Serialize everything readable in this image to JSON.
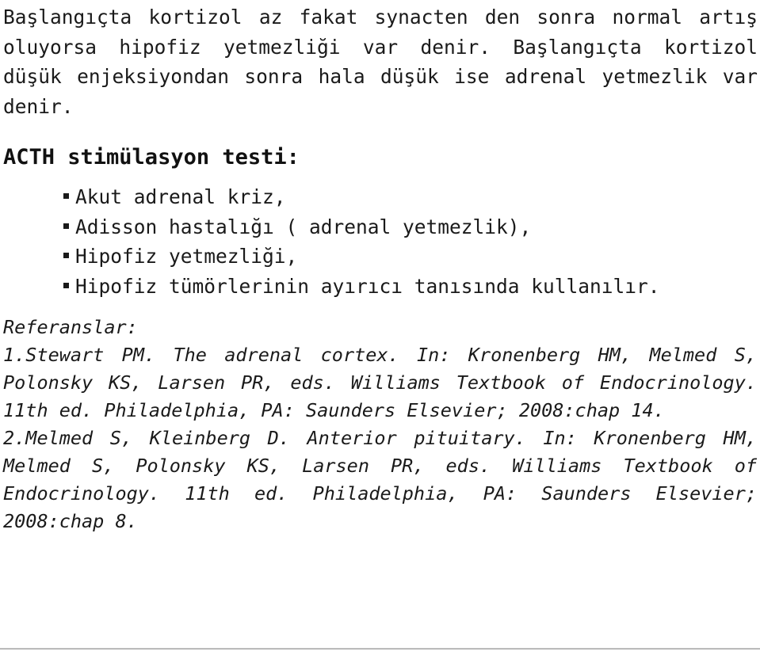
{
  "document": {
    "background_color": "#ffffff",
    "text_color": "#1a1a1a",
    "divider_color": "#a8a8a8"
  },
  "intro": {
    "paragraph": "Başlangıçta kortizol az fakat synacten den sonra normal artış oluyorsa hipofiz yetmezliği var denir. Başlangıçta kortizol düşük enjeksiyondan sonra hala düşük ise adrenal yetmezlik var denir."
  },
  "section": {
    "heading": "ACTH stimülasyon testi:",
    "bullet_glyph": "square-bullet-icon",
    "bullets": [
      {
        "label": "Akut adrenal kriz,"
      },
      {
        "label": "Adisson hastalığı ( adrenal yetmezlik),"
      },
      {
        "label": "Hipofiz yetmezliği,"
      },
      {
        "label": "Hipofiz tümörlerinin ayırıcı tanısında kullanılır."
      }
    ]
  },
  "references": {
    "title": "Referanslar:",
    "items": [
      {
        "number": "1.",
        "text": "1.Stewart PM. The adrenal cortex. In: Kronenberg HM, Melmed S, Polonsky KS, Larsen PR, eds. Williams Textbook of Endocrinology. 11th ed. Philadelphia, PA: Saunders Elsevier; 2008:chap 14."
      },
      {
        "number": "2.",
        "text": "2.Melmed S, Kleinberg D. Anterior pituitary. In: Kronenberg HM, Melmed S, Polonsky KS, Larsen PR, eds. Williams Textbook of Endocrinology. 11th ed. Philadelphia, PA: Saunders Elsevier; 2008:chap 8."
      }
    ]
  }
}
